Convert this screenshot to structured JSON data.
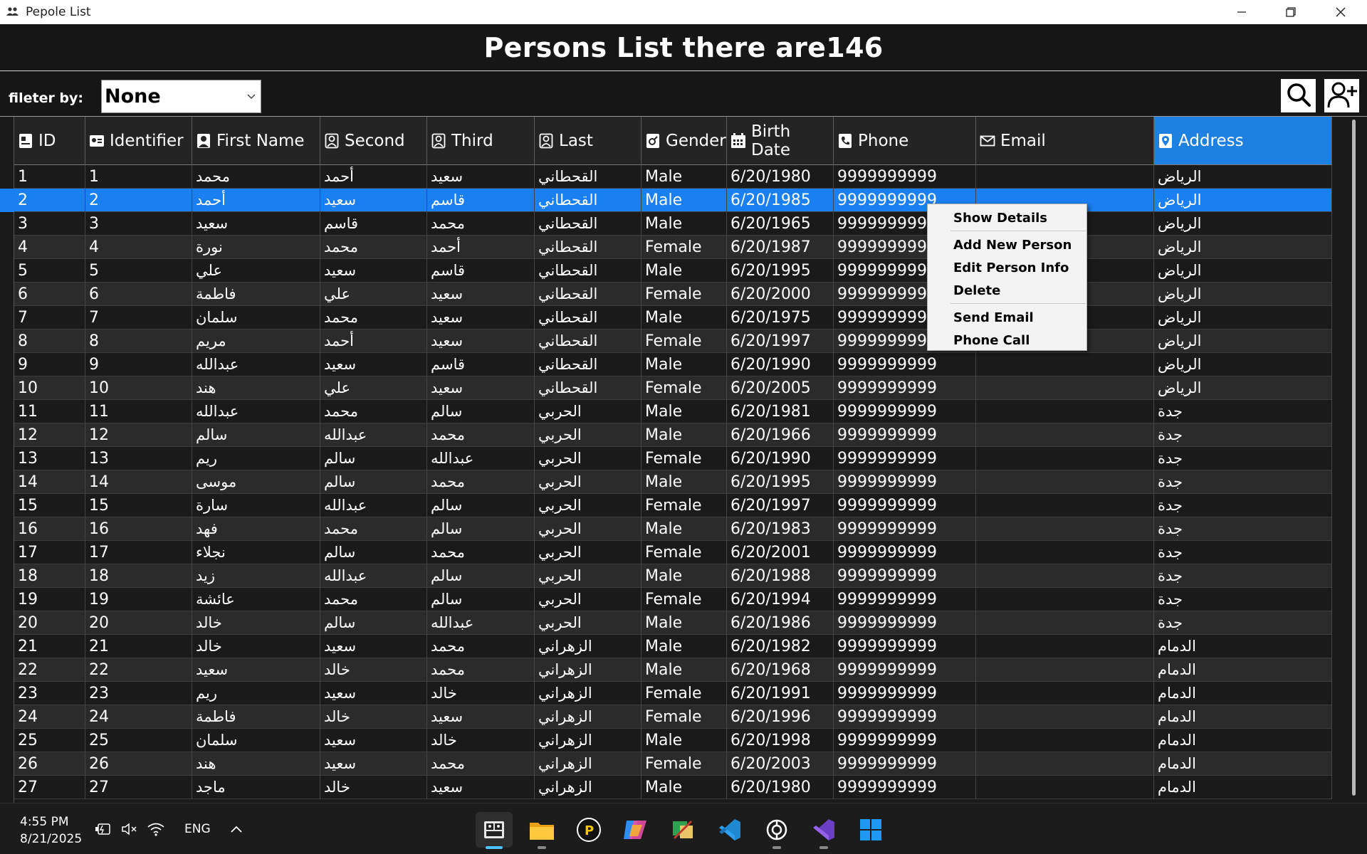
{
  "window": {
    "title": "Pepole List",
    "icon": "people-icon"
  },
  "header": {
    "title": "Persons List there are146"
  },
  "toolbar": {
    "filter_label": "fileter by:",
    "filter_value": "None",
    "search_icon": "search-icon",
    "add_icon": "add-person-icon"
  },
  "columns": [
    {
      "label": "ID",
      "icon": "id-card-icon"
    },
    {
      "label": "Identifier",
      "icon": "id-badge-icon"
    },
    {
      "label": "First Name",
      "icon": "person-icon"
    },
    {
      "label": "Second",
      "icon": "person-outline-icon"
    },
    {
      "label": "Third",
      "icon": "person-outline-icon"
    },
    {
      "label": "Last",
      "icon": "person-outline-icon"
    },
    {
      "label": "Gender",
      "icon": "gender-icon"
    },
    {
      "label": "Birth Date",
      "icon": "calendar-icon"
    },
    {
      "label": "Phone",
      "icon": "phone-icon"
    },
    {
      "label": "Email",
      "icon": "mail-icon"
    },
    {
      "label": "Address",
      "icon": "location-pin-icon"
    }
  ],
  "selected_column": "Address",
  "selected_row_index": 1,
  "rows": [
    [
      "1",
      "1",
      "محمد",
      "أحمد",
      "سعيد",
      "القحطاني",
      "Male",
      "6/20/1980",
      "9999999999",
      "",
      "الرياض"
    ],
    [
      "2",
      "2",
      "أحمد",
      "سعيد",
      "قاسم",
      "القحطاني",
      "Male",
      "6/20/1985",
      "9999999999",
      "",
      "الرياض"
    ],
    [
      "3",
      "3",
      "سعيد",
      "قاسم",
      "محمد",
      "القحطاني",
      "Male",
      "6/20/1965",
      "9999999999",
      "",
      "الرياض"
    ],
    [
      "4",
      "4",
      "نورة",
      "محمد",
      "أحمد",
      "القحطاني",
      "Female",
      "6/20/1987",
      "9999999999",
      "",
      "الرياض"
    ],
    [
      "5",
      "5",
      "علي",
      "سعيد",
      "قاسم",
      "القحطاني",
      "Male",
      "6/20/1995",
      "9999999999",
      "",
      "الرياض"
    ],
    [
      "6",
      "6",
      "فاطمة",
      "علي",
      "سعيد",
      "القحطاني",
      "Female",
      "6/20/2000",
      "9999999999",
      "",
      "الرياض"
    ],
    [
      "7",
      "7",
      "سلمان",
      "محمد",
      "سعيد",
      "القحطاني",
      "Male",
      "6/20/1975",
      "9999999999",
      "",
      "الرياض"
    ],
    [
      "8",
      "8",
      "مريم",
      "أحمد",
      "سعيد",
      "القحطاني",
      "Female",
      "6/20/1997",
      "9999999999",
      "",
      "الرياض"
    ],
    [
      "9",
      "9",
      "عبدالله",
      "سعيد",
      "قاسم",
      "القحطاني",
      "Male",
      "6/20/1990",
      "9999999999",
      "",
      "الرياض"
    ],
    [
      "10",
      "10",
      "هند",
      "علي",
      "سعيد",
      "القحطاني",
      "Female",
      "6/20/2005",
      "9999999999",
      "",
      "الرياض"
    ],
    [
      "11",
      "11",
      "عبدالله",
      "محمد",
      "سالم",
      "الحربي",
      "Male",
      "6/20/1981",
      "9999999999",
      "",
      "جدة"
    ],
    [
      "12",
      "12",
      "سالم",
      "عبدالله",
      "محمد",
      "الحربي",
      "Male",
      "6/20/1966",
      "9999999999",
      "",
      "جدة"
    ],
    [
      "13",
      "13",
      "ريم",
      "سالم",
      "عبدالله",
      "الحربي",
      "Female",
      "6/20/1990",
      "9999999999",
      "",
      "جدة"
    ],
    [
      "14",
      "14",
      "موسى",
      "سالم",
      "محمد",
      "الحربي",
      "Male",
      "6/20/1995",
      "9999999999",
      "",
      "جدة"
    ],
    [
      "15",
      "15",
      "سارة",
      "عبدالله",
      "سالم",
      "الحربي",
      "Female",
      "6/20/1997",
      "9999999999",
      "",
      "جدة"
    ],
    [
      "16",
      "16",
      "فهد",
      "محمد",
      "سالم",
      "الحربي",
      "Male",
      "6/20/1983",
      "9999999999",
      "",
      "جدة"
    ],
    [
      "17",
      "17",
      "نجلاء",
      "سالم",
      "محمد",
      "الحربي",
      "Female",
      "6/20/2001",
      "9999999999",
      "",
      "جدة"
    ],
    [
      "18",
      "18",
      "زيد",
      "عبدالله",
      "سالم",
      "الحربي",
      "Male",
      "6/20/1988",
      "9999999999",
      "",
      "جدة"
    ],
    [
      "19",
      "19",
      "عائشة",
      "محمد",
      "سالم",
      "الحربي",
      "Female",
      "6/20/1994",
      "9999999999",
      "",
      "جدة"
    ],
    [
      "20",
      "20",
      "خالد",
      "سالم",
      "عبدالله",
      "الحربي",
      "Male",
      "6/20/1986",
      "9999999999",
      "",
      "جدة"
    ],
    [
      "21",
      "21",
      "خالد",
      "سعيد",
      "محمد",
      "الزهراني",
      "Male",
      "6/20/1982",
      "9999999999",
      "",
      "الدمام"
    ],
    [
      "22",
      "22",
      "سعيد",
      "خالد",
      "محمد",
      "الزهراني",
      "Male",
      "6/20/1968",
      "9999999999",
      "",
      "الدمام"
    ],
    [
      "23",
      "23",
      "ريم",
      "سعيد",
      "خالد",
      "الزهراني",
      "Female",
      "6/20/1991",
      "9999999999",
      "",
      "الدمام"
    ],
    [
      "24",
      "24",
      "فاطمة",
      "خالد",
      "سعيد",
      "الزهراني",
      "Female",
      "6/20/1996",
      "9999999999",
      "",
      "الدمام"
    ],
    [
      "25",
      "25",
      "سلمان",
      "سعيد",
      "خالد",
      "الزهراني",
      "Male",
      "6/20/1998",
      "9999999999",
      "",
      "الدمام"
    ],
    [
      "26",
      "26",
      "هند",
      "سعيد",
      "محمد",
      "الزهراني",
      "Female",
      "6/20/2003",
      "9999999999",
      "",
      "الدمام"
    ],
    [
      "27",
      "27",
      "ماجد",
      "خالد",
      "سعيد",
      "الزهراني",
      "Male",
      "6/20/1980",
      "9999999999",
      "",
      "الدمام"
    ]
  ],
  "context_menu": {
    "items": [
      "Show Details",
      "Add New Person",
      "Edit Person Info",
      "Delete",
      "Send Email",
      "Phone Call"
    ]
  },
  "taskbar": {
    "time": "4:55 PM",
    "date": "8/21/2025",
    "language": "ENG",
    "tray_icons": [
      "battery-icon",
      "speaker-muted-icon",
      "wifi-icon",
      "chevron-up-icon"
    ],
    "apps": [
      "people-list-app-icon",
      "file-explorer-icon",
      "parsec-icon",
      "copilot-icon",
      "photo-editor-icon",
      "vscode-icon",
      "chatgpt-icon",
      "visual-studio-icon",
      "windows-start-icon"
    ]
  },
  "colors": {
    "selection": "#1a7ff0",
    "header_selected": "#1e80e0",
    "background": "#1a1a1a",
    "alt_row": "#2b2b2b"
  }
}
